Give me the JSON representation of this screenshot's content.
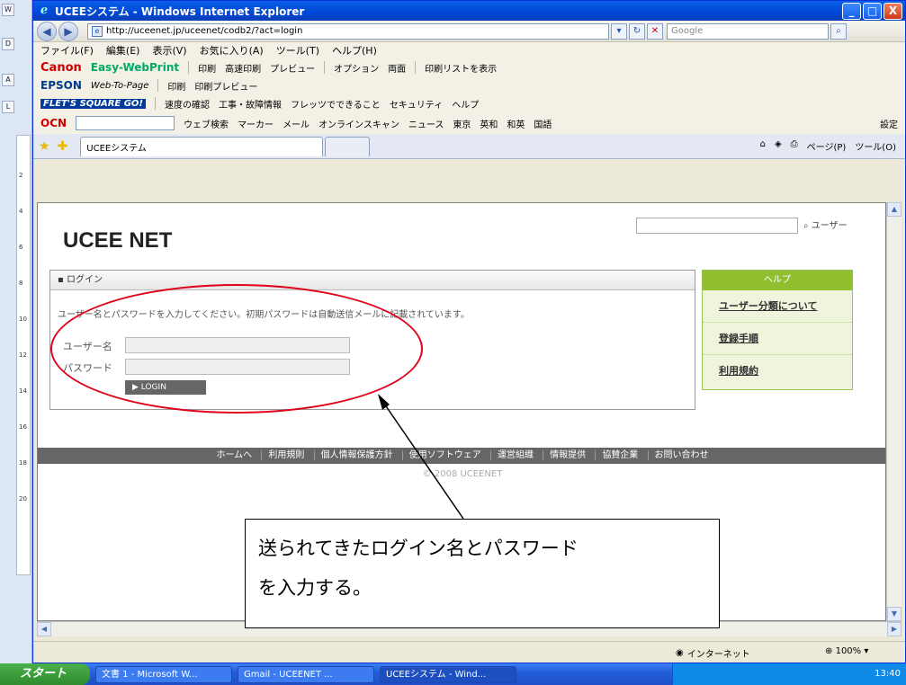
{
  "window": {
    "title": "UCEEシステム - Windows Internet Explorer",
    "min": "_",
    "max": "□",
    "close": "X"
  },
  "address": {
    "url": "http://uceenet.jp/uceenet/codb2/?act=login",
    "search_placeholder": "Google"
  },
  "menu": [
    "ファイル(F)",
    "編集(E)",
    "表示(V)",
    "お気に入り(A)",
    "ツール(T)",
    "ヘルプ(H)"
  ],
  "canon_bar": {
    "brand": "Canon",
    "product": "Easy-WebPrint",
    "items": [
      "印刷",
      "高速印刷",
      "プレビュー",
      "オプション",
      "両面",
      "印刷リストを表示"
    ]
  },
  "epson_bar": {
    "brand": "EPSON",
    "product": "Web-To-Page",
    "items": [
      "印刷",
      "印刷プレビュー"
    ]
  },
  "flets_bar": {
    "brand": "FLET'S SQUARE GO!",
    "items": [
      "速度の確認",
      "工事・故障情報",
      "フレッツでできること",
      "セキュリティ",
      "ヘルプ"
    ]
  },
  "ocn_bar": {
    "brand": "OCN",
    "items": [
      "ウェブ検索",
      "マーカー",
      "メール",
      "オンラインスキャン",
      "ニュース",
      "東京",
      "英和",
      "和英",
      "国語"
    ],
    "settings": "設定"
  },
  "tabs": {
    "active_label": "UCEEシステム",
    "tools": [
      "ページ(P)",
      "ツール(O)"
    ]
  },
  "site": {
    "title": "UCEE NET",
    "user_link": "ユーザー"
  },
  "login": {
    "header": "ログイン",
    "message": "ユーザー名とパスワードを入力してください。初期パスワードは自動送信メールに記載されています。",
    "username_label": "ユーザー名",
    "password_label": "パスワード",
    "button": "▶ LOGIN"
  },
  "help": {
    "header": "ヘルプ",
    "items": [
      "ユーザー分類について",
      "登録手順",
      "利用規約"
    ]
  },
  "footer": {
    "links": [
      "ホームへ",
      "利用規則",
      "個人情報保護方針",
      "使用ソフトウェア",
      "運営組織",
      "情報提供",
      "協賛企業",
      "お問い合わせ"
    ],
    "copyright": "© 2008 UCEENET"
  },
  "callout": {
    "line1": "送られてきたログイン名とパスワード",
    "line2": "を入力する。"
  },
  "status": {
    "zone": "インターネット",
    "zoom": "100%"
  },
  "taskbar": {
    "start": "スタート",
    "tasks": [
      "文書 1 - Microsoft W...",
      "Gmail - UCEENET ...",
      "UCEEシステム - Wind..."
    ],
    "clock": "13:40"
  },
  "colors": {
    "annotation_red": "#e0001a",
    "help_green": "#8fbf2e",
    "footer_gray": "#666666"
  }
}
